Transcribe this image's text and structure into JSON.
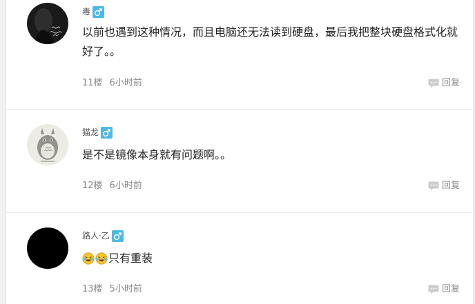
{
  "comments": [
    {
      "username": "毒",
      "gender": "male",
      "content": "以前也遇到这种情况，而且电脑还无法读到硬盘，最后我把整块硬盘格式化就好了。。",
      "floor": "11楼",
      "time": "6小时前",
      "reply_label": "回复",
      "avatar": "dark-portrait-avatar"
    },
    {
      "username": "猫龙",
      "gender": "male",
      "content": "是不是镜像本身就有问题啊。。",
      "floor": "12楼",
      "time": "6小时前",
      "reply_label": "回复",
      "avatar": "totoro-avatar"
    },
    {
      "username": "路人·乙",
      "gender": "male",
      "emojis": [
        "laughing-crying-emoji",
        "laughing-crying-emoji"
      ],
      "content": "只有重装",
      "floor": "13楼",
      "time": "5小时前",
      "reply_label": "回复",
      "avatar": "black-circle-avatar"
    }
  ],
  "colors": {
    "gender_badge": "#4db8e8",
    "meta_text": "#888888",
    "divider": "#e8e8e8"
  }
}
